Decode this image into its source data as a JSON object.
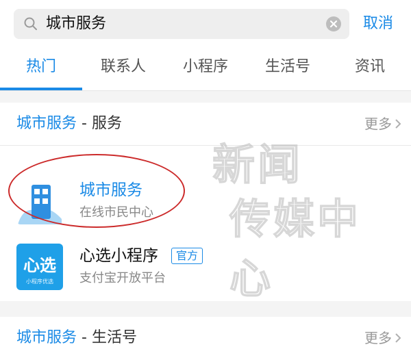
{
  "search": {
    "query": "城市服务",
    "cancel_label": "取消"
  },
  "tabs": [
    {
      "label": "热门",
      "active": true
    },
    {
      "label": "联系人",
      "active": false
    },
    {
      "label": "小程序",
      "active": false
    },
    {
      "label": "生活号",
      "active": false
    },
    {
      "label": "资讯",
      "active": false
    }
  ],
  "services_section": {
    "title_highlight": "城市服务",
    "title_suffix": " - 服务",
    "more_label": "更多",
    "results": [
      {
        "title": "城市服务",
        "subtitle": "在线市民中心",
        "icon": "building-icon"
      },
      {
        "title": "心选小程序",
        "badge": "官方",
        "subtitle": "支付宝开放平台",
        "icon": "xinxuan-logo",
        "icon_text": "心选",
        "icon_caption": "小程序优选"
      }
    ]
  },
  "life_section": {
    "title_highlight": "城市服务",
    "title_suffix": " - 生活号",
    "more_label": "更多"
  },
  "watermark": {
    "line1": "新闻",
    "line2": "传媒中心"
  },
  "colors": {
    "accent": "#1a8ae6",
    "annotation": "#cc2b2b"
  }
}
